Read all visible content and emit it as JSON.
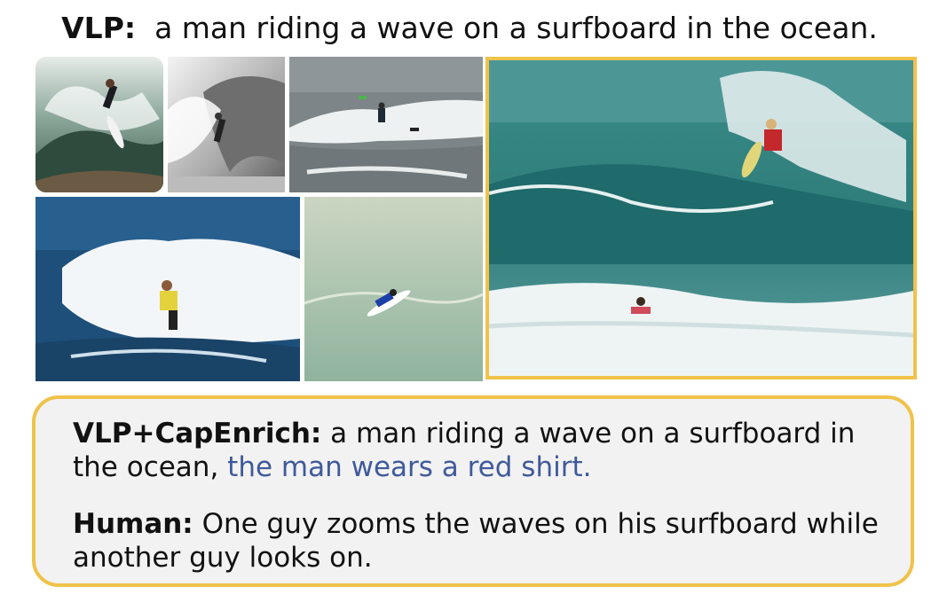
{
  "vlp": {
    "label": "VLP:",
    "caption": "a man riding a wave on a surfboard in the ocean."
  },
  "panel": {
    "enriched_label": "VLP+CapEnrich:",
    "enriched_text": "a man riding a wave on a surfboard in the ocean,",
    "enriched_highlight": "the man wears a red shirt.",
    "human_label": "Human:",
    "human_text": "One guy zooms the waves on his surfboard while another guy looks on."
  },
  "colors": {
    "frame": "#efc24a",
    "highlight": "#3f5a9b",
    "panel_bg": "#f2f2f2"
  }
}
